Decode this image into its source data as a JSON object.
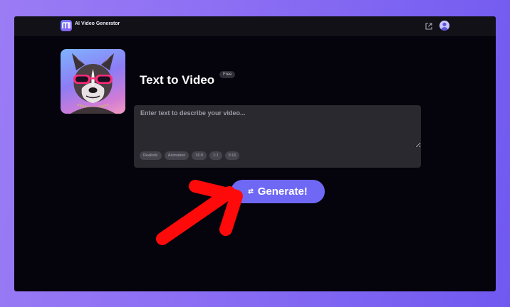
{
  "app": {
    "brand": "AI Video Generator",
    "logo_letter": "m",
    "icons": {
      "share": "share-external-icon",
      "user": "user-avatar-icon"
    }
  },
  "main": {
    "title": "Text to Video",
    "badge": "Free",
    "thumbnail": "french-bulldog-sunglasses-image"
  },
  "prompt": {
    "placeholder": "Enter text to describe your video...",
    "value": "",
    "chips": [
      "Realistic",
      "Animation",
      "16:9",
      "1:1",
      "9:16"
    ]
  },
  "generate": {
    "label": "Generate!",
    "icon": "swap-arrows-icon"
  },
  "annotation": {
    "type": "red-arrow",
    "color": "#ff0a0a",
    "points_to": "generate-button"
  },
  "colors": {
    "frame_background": "#05040c",
    "outer_gradient": [
      "#9b7cf5",
      "#7059f0"
    ],
    "accent": "#6f68f4",
    "topbar": "#121118",
    "input_background": "#2a292f"
  }
}
